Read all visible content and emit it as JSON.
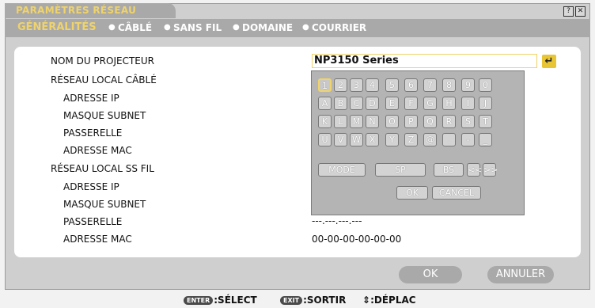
{
  "window": {
    "title": "PARAMÈTRES RÉSEAU",
    "help_btn": "?",
    "close_btn": "✕"
  },
  "tabs": [
    "GÉNÉRALITÉS",
    "CÂBLÉ",
    "SANS FIL",
    "DOMAINE",
    "COURRIER"
  ],
  "fields": {
    "projector_name_label": "NOM DU PROJECTEUR",
    "wired_lan_label": "RÉSEAU LOCAL CÂBLÉ",
    "wired_ip_label": "ADRESSE IP",
    "wired_mask_label": "MASQUE SUBNET",
    "wired_gateway_label": "PASSERELLE",
    "wired_mac_label": "ADRESSE MAC",
    "wireless_lan_label": "RÉSEAU LOCAL SS FIL",
    "wireless_ip_label": "ADRESSE IP",
    "wireless_mask_label": "MASQUE SUBNET",
    "wireless_gateway_label": "PASSERELLE",
    "wireless_mac_label": "ADRESSE MAC",
    "projector_name_value": "NP3150 Series",
    "wireless_gateway_value": "---.---.---.---",
    "wireless_mac_value": "00-00-00-00-00-00"
  },
  "keyboard": {
    "row1": [
      "1",
      "2",
      "3",
      "4",
      "5",
      "6",
      "7",
      "8",
      "9",
      "0"
    ],
    "row2": [
      "A",
      "B",
      "C",
      "D",
      "E",
      "F",
      "G",
      "H",
      "I",
      "J"
    ],
    "row3": [
      "K",
      "L",
      "M",
      "N",
      "O",
      "P",
      "Q",
      "R",
      "S",
      "T"
    ],
    "row4": [
      "U",
      "V",
      "W",
      "X",
      "Y",
      "Z",
      "@",
      ".",
      "-",
      "_"
    ],
    "mode": "MODE",
    "sp": "SP",
    "bs": "BS",
    "left": "<<",
    "right": ">>",
    "ok": "OK",
    "cancel": "CANCEL"
  },
  "buttons": {
    "ok": "OK",
    "cancel": "ANNULER"
  },
  "footer": {
    "enter_chip": "ENTER",
    "enter_text": ":SÉLECT",
    "exit_chip": "EXIT",
    "exit_text": ":SORTIR",
    "move_icon": "⇕",
    "move_text": ":DÉPLAC"
  },
  "colors": {
    "accent": "#f0d36a",
    "header": "#a9a9a9"
  }
}
